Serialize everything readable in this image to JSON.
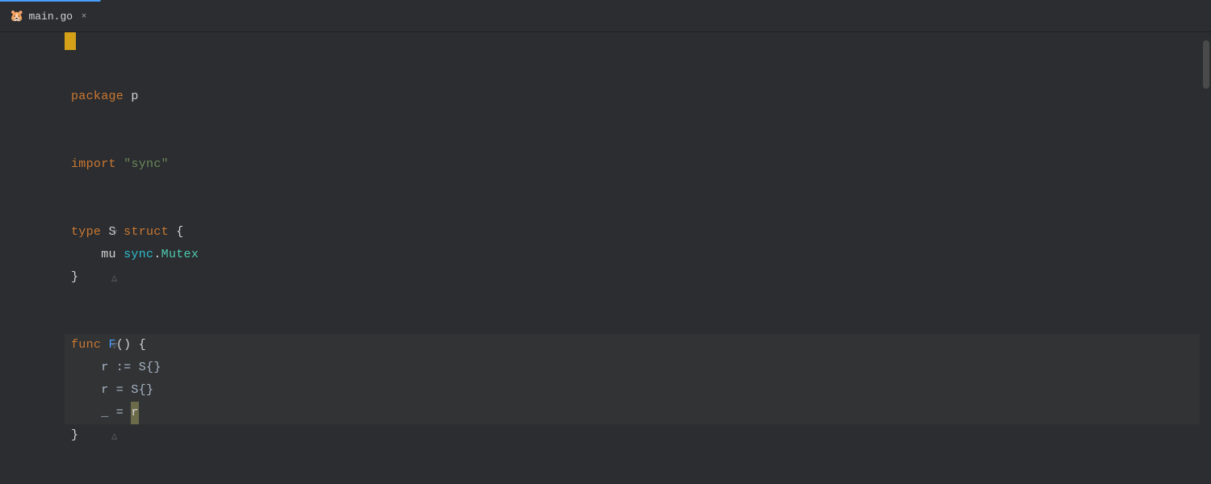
{
  "tab": {
    "icon": "🐹",
    "label": "main.go",
    "close_label": "×",
    "active": true
  },
  "editor": {
    "background": "#2b2d30",
    "lines": [
      {
        "id": 1,
        "blank": true
      },
      {
        "id": 2,
        "blank": true
      },
      {
        "id": 3,
        "content": "package p",
        "type": "package"
      },
      {
        "id": 4,
        "blank": true
      },
      {
        "id": 5,
        "blank": true
      },
      {
        "id": 6,
        "content": "import \"sync\"",
        "type": "import"
      },
      {
        "id": 7,
        "blank": true
      },
      {
        "id": 8,
        "blank": true
      },
      {
        "id": 9,
        "content": "type S struct {",
        "type": "type_decl",
        "foldable": true
      },
      {
        "id": 10,
        "content": "    mu sync.Mutex",
        "type": "field"
      },
      {
        "id": 11,
        "content": "}",
        "type": "close_brace",
        "foldable": true
      },
      {
        "id": 12,
        "blank": true
      },
      {
        "id": 13,
        "blank": true
      },
      {
        "id": 14,
        "content": "func F() {",
        "type": "func_decl",
        "foldable": true,
        "highlighted": true
      },
      {
        "id": 15,
        "content": "    r := S{}",
        "type": "stmt",
        "highlighted": true
      },
      {
        "id": 16,
        "content": "    r = S{}",
        "type": "stmt",
        "highlighted": true
      },
      {
        "id": 17,
        "content": "    _ = r",
        "type": "stmt_cursor",
        "highlighted": true
      },
      {
        "id": 18,
        "content": "}",
        "type": "close_brace_func",
        "foldable": true
      }
    ]
  },
  "minimap": {
    "dot_positions": [
      {
        "line": 14,
        "color": "yellow"
      },
      {
        "line": 9,
        "color": "green"
      }
    ]
  }
}
